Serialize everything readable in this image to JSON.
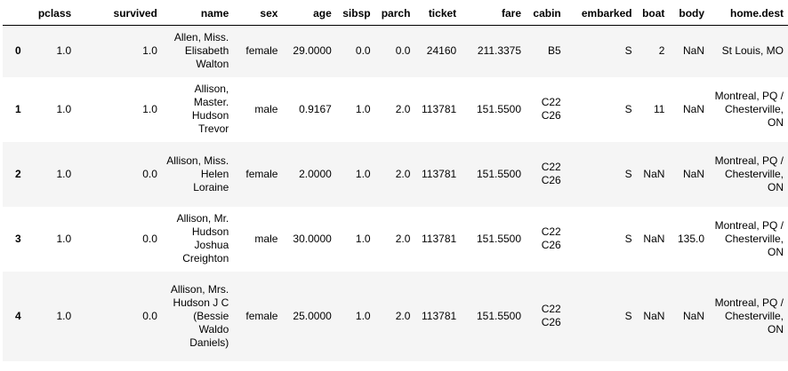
{
  "table": {
    "columns": [
      "",
      "pclass",
      "survived",
      "name",
      "sex",
      "age",
      "sibsp",
      "parch",
      "ticket",
      "fare",
      "cabin",
      "embarked",
      "boat",
      "body",
      "home.dest"
    ],
    "rows": [
      [
        "0",
        "1.0",
        "1.0",
        "Allen, Miss. Elisabeth Walton",
        "female",
        "29.0000",
        "0.0",
        "0.0",
        "24160",
        "211.3375",
        "B5",
        "S",
        "2",
        "NaN",
        "St Louis, MO"
      ],
      [
        "1",
        "1.0",
        "1.0",
        "Allison, Master. Hudson Trevor",
        "male",
        "0.9167",
        "1.0",
        "2.0",
        "113781",
        "151.5500",
        "C22 C26",
        "S",
        "11",
        "NaN",
        "Montreal, PQ / Chesterville, ON"
      ],
      [
        "2",
        "1.0",
        "0.0",
        "Allison, Miss. Helen Loraine",
        "female",
        "2.0000",
        "1.0",
        "2.0",
        "113781",
        "151.5500",
        "C22 C26",
        "S",
        "NaN",
        "NaN",
        "Montreal, PQ / Chesterville, ON"
      ],
      [
        "3",
        "1.0",
        "0.0",
        "Allison, Mr. Hudson Joshua Creighton",
        "male",
        "30.0000",
        "1.0",
        "2.0",
        "113781",
        "151.5500",
        "C22 C26",
        "S",
        "NaN",
        "135.0",
        "Montreal, PQ / Chesterville, ON"
      ],
      [
        "4",
        "1.0",
        "0.0",
        "Allison, Mrs. Hudson J C (Bessie Waldo Daniels)",
        "female",
        "25.0000",
        "1.0",
        "2.0",
        "113781",
        "151.5500",
        "C22 C26",
        "S",
        "NaN",
        "NaN",
        "Montreal, PQ / Chesterville, ON"
      ]
    ]
  }
}
